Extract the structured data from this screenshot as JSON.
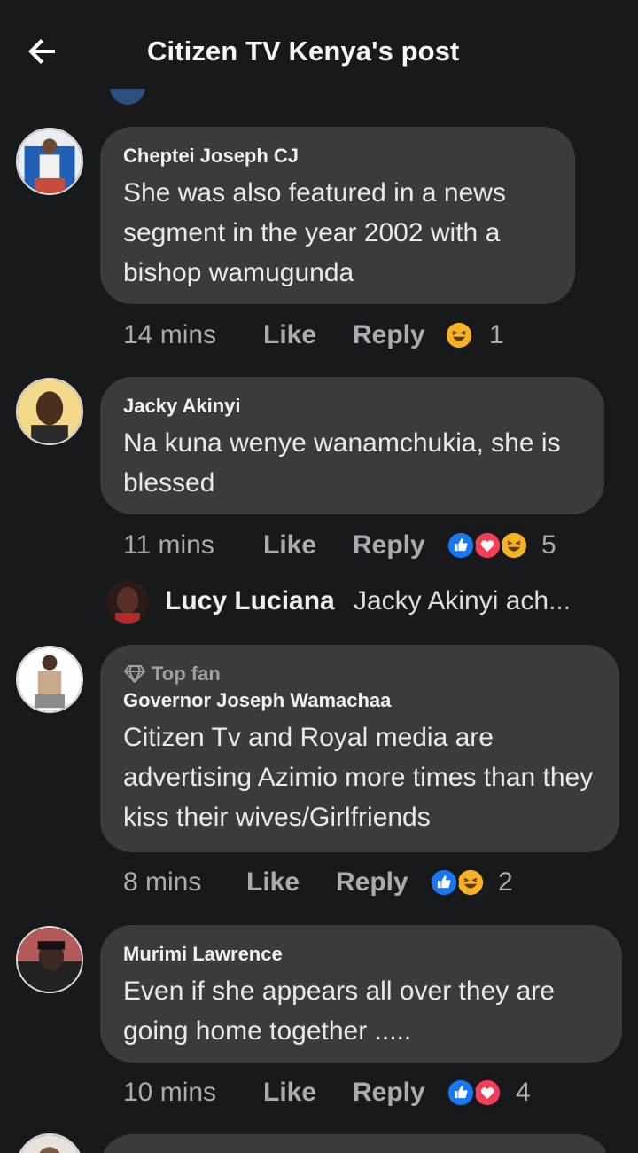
{
  "header": {
    "title": "Citizen TV Kenya's post",
    "back_icon": "arrow-left-icon"
  },
  "comments": [
    {
      "author": "Cheptei Joseph CJ",
      "text": "She was also featured in a news segment in the year 2002 with a bishop wamugunda",
      "time": "14 mins",
      "like_label": "Like",
      "reply_label": "Reply",
      "reactions": [
        "haha"
      ],
      "reaction_count": "1"
    },
    {
      "author": "Jacky Akinyi",
      "text": "Na kuna wenye wanamchukia, she is blessed",
      "time": "11 mins",
      "like_label": "Like",
      "reply_label": "Reply",
      "reactions": [
        "like",
        "love",
        "haha"
      ],
      "reaction_count": "5",
      "reply_preview": {
        "author": "Lucy Luciana",
        "text": "Jacky Akinyi ach..."
      }
    },
    {
      "badge": "Top fan",
      "badge_icon": "diamond-icon",
      "author": "Governor Joseph Wamachaa",
      "text": "Citizen Tv and Royal media are advertising Azimio more times than they kiss their wives/Girlfriends",
      "time": "8 mins",
      "like_label": "Like",
      "reply_label": "Reply",
      "reactions": [
        "like",
        "haha"
      ],
      "reaction_count": "2"
    },
    {
      "author": "Murimi Lawrence",
      "text": "Even if she appears all over they are going home together .....",
      "time": "10 mins",
      "like_label": "Like",
      "reply_label": "Reply",
      "reactions": [
        "like",
        "love"
      ],
      "reaction_count": "4"
    }
  ],
  "colors": {
    "background": "#18191a",
    "bubble": "#3a3b3c",
    "like_blue": "#1877f2",
    "love_red": "#f33e58",
    "haha_yellow": "#f7b125",
    "muted_text": "#a8abaf"
  }
}
